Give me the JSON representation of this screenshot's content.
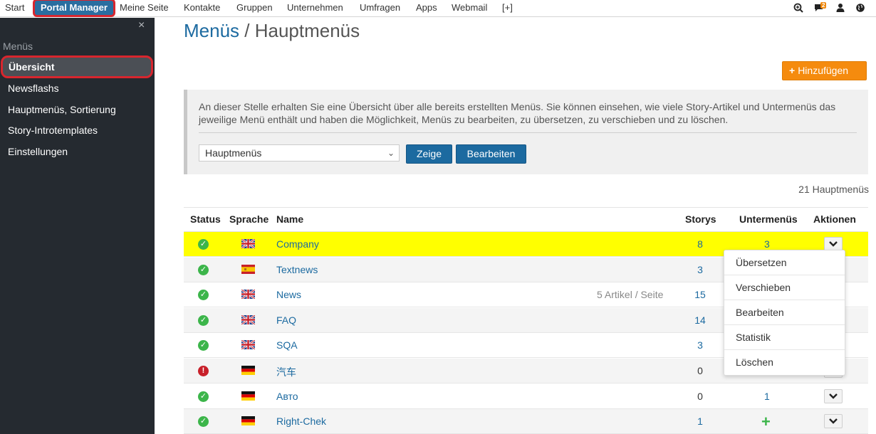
{
  "topnav": {
    "items": [
      "Start",
      "Portal Manager",
      "Meine Seite",
      "Kontakte",
      "Gruppen",
      "Unternehmen",
      "Umfragen",
      "Apps",
      "Webmail",
      "[+]"
    ],
    "messages_badge": "2",
    "icons": [
      "search-plus-icon",
      "chat-icon",
      "user-icon",
      "globe-icon"
    ]
  },
  "sidebar": {
    "section": "Menüs",
    "items": [
      "Übersicht",
      "Newsflashs",
      "Hauptmenüs, Sortierung",
      "Story-Introtemplates",
      "Einstellungen"
    ],
    "close": "×"
  },
  "page": {
    "title_crumb": "Menüs",
    "title_sep": " / ",
    "title_current": "Hauptmenüs",
    "add_button": "Hinzufügen",
    "info_text": "An dieser Stelle erhalten Sie eine Übersicht über alle bereits erstellten Menüs. Sie können einsehen, wie viele Story-Artikel und Untermenüs das jeweilige Menü enthält und haben die Möglichkeit, Menüs zu bearbeiten, zu übersetzen, zu verschieben und zu löschen.",
    "select_value": "Hauptmenüs",
    "show_button": "Zeige",
    "edit_button": "Bearbeiten",
    "count": "21 Hauptmenüs"
  },
  "table": {
    "headers": {
      "status": "Status",
      "language": "Sprache",
      "name": "Name",
      "storys": "Storys",
      "submenus": "Untermenüs",
      "actions": "Aktionen"
    },
    "rows": [
      {
        "status": "ok",
        "flag": "uk",
        "name": "Company",
        "note": "",
        "storys": "8",
        "submenus": "3"
      },
      {
        "status": "ok",
        "flag": "es",
        "name": "Textnews",
        "note": "",
        "storys": "3",
        "submenus": ""
      },
      {
        "status": "ok",
        "flag": "uk",
        "name": "News",
        "note": "5 Artikel / Seite",
        "storys": "15",
        "submenus": ""
      },
      {
        "status": "ok",
        "flag": "uk",
        "name": "FAQ",
        "note": "",
        "storys": "14",
        "submenus": ""
      },
      {
        "status": "ok",
        "flag": "uk",
        "name": "SQA",
        "note": "",
        "storys": "3",
        "submenus": ""
      },
      {
        "status": "error",
        "flag": "de",
        "name": "汽车",
        "note": "",
        "storys": "0",
        "submenus": ""
      },
      {
        "status": "ok",
        "flag": "de",
        "name": "Авто",
        "note": "",
        "storys": "0",
        "submenus": "1"
      },
      {
        "status": "ok",
        "flag": "de",
        "name": "Right-Chek",
        "note": "",
        "storys": "1",
        "submenus": "+"
      }
    ]
  },
  "dropdown": {
    "items": [
      "Übersetzen",
      "Verschieben",
      "Bearbeiten",
      "Statistik",
      "Löschen"
    ]
  },
  "colors": {
    "brand_blue": "#1c6aa0",
    "accent_orange": "#f58b0e",
    "highlight_yellow": "#ffff00",
    "sidebar_bg": "#252a30",
    "status_ok": "#3cb54a",
    "status_error": "#c8202a"
  }
}
